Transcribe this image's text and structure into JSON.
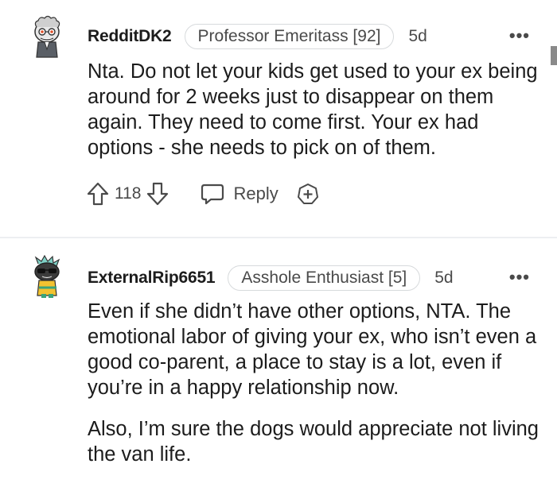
{
  "comments": [
    {
      "username": "RedditDK2",
      "flair": "Professor Emeritass [92]",
      "time": "5d",
      "more": "•••",
      "paragraphs": [
        "Nta. Do not let your kids get used to your ex being around for 2 weeks just to disappear on them again. They need to come first. Your ex had options - she needs to pick on of them."
      ],
      "votes": "118",
      "reply_label": "Reply",
      "avatar_icon": "reddit-snoo-professor-avatar-icon"
    },
    {
      "username": "ExternalRip6651",
      "flair": "Asshole Enthusiast [5]",
      "time": "5d",
      "more": "•••",
      "paragraphs": [
        "Even if she didn’t have other options, NTA. The emotional labor of giving your ex, who isn’t even a good co-parent, a place to stay is a lot, even if you’re in a happy relationship now.",
        "Also, I’m sure the dogs would appreciate not living the van life."
      ],
      "avatar_icon": "reddit-snoo-sunglasses-avatar-icon"
    }
  ],
  "colors": {
    "text": "#1c1c1c",
    "muted": "#4a4a4a",
    "border": "#d7dadc",
    "divider": "#edeff1"
  },
  "icons": {
    "upvote": "arrow-up-outline-icon",
    "downvote": "arrow-down-outline-icon",
    "reply": "speech-bubble-icon",
    "award": "plus-circle-award-icon",
    "more": "more-options-icon"
  }
}
